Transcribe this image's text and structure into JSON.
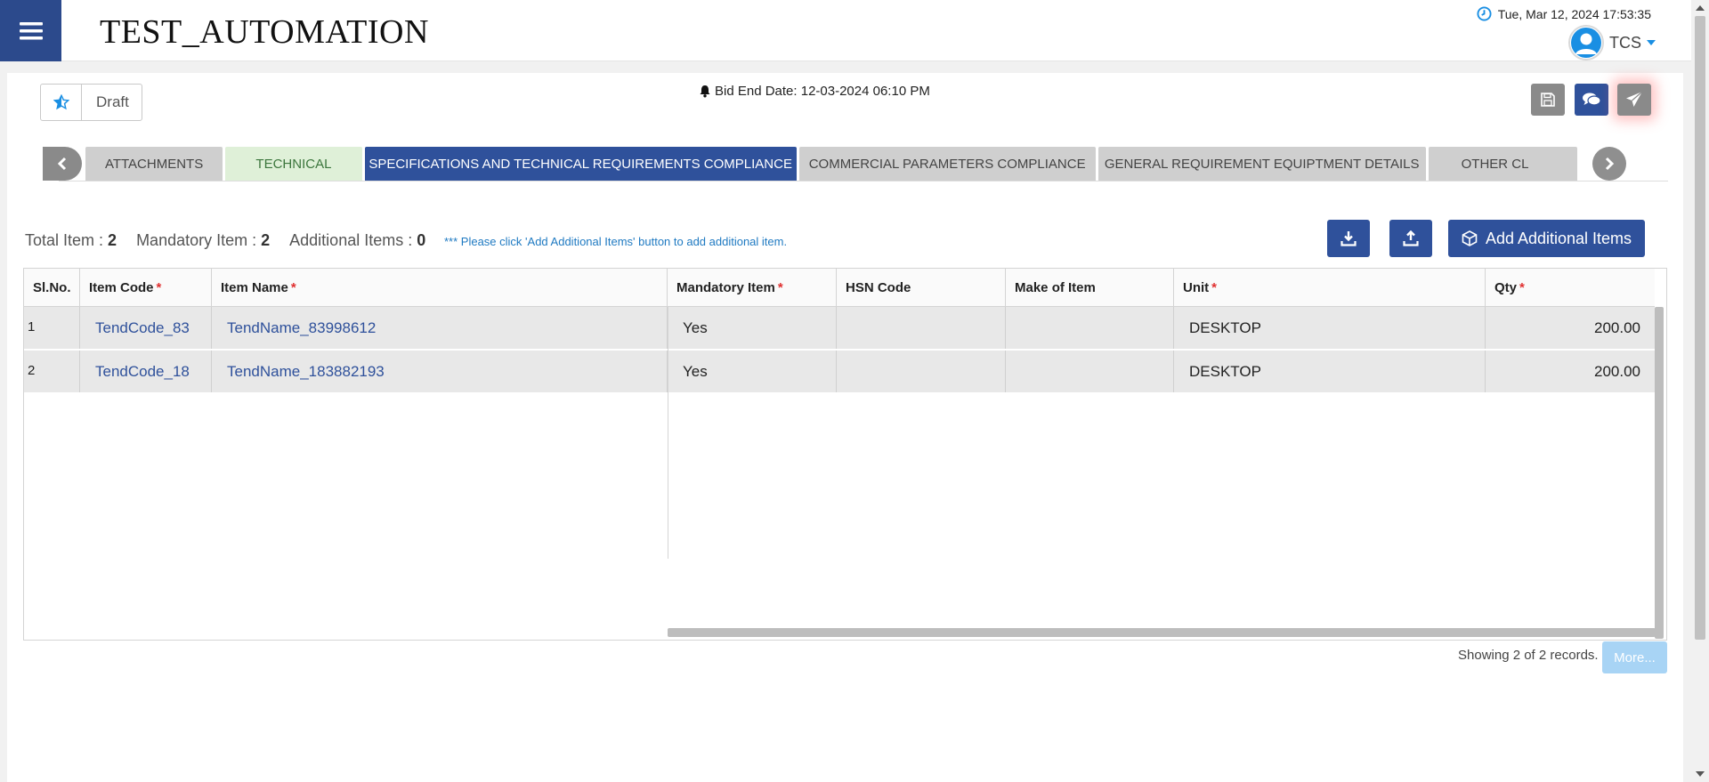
{
  "app": {
    "title": "TEST_AUTOMATION"
  },
  "header": {
    "datetime": "Tue, Mar 12, 2024 17:53:35",
    "user": "TCS"
  },
  "breadcrumb": {
    "status": "Draft"
  },
  "bid": {
    "end_label": "Bid End Date: 12-03-2024 06:10 PM"
  },
  "tabs": [
    {
      "label": "ATTACHMENTS",
      "state": "normal"
    },
    {
      "label": "TECHNICAL",
      "state": "success"
    },
    {
      "label": "SPECIFICATIONS AND TECHNICAL REQUIREMENTS COMPLIANCE",
      "state": "active"
    },
    {
      "label": "COMMERCIAL PARAMETERS COMPLIANCE",
      "state": "normal"
    },
    {
      "label": "GENERAL REQUIREMENT EQUIPTMENT DETAILS",
      "state": "normal"
    },
    {
      "label": "OTHER CL",
      "state": "normal"
    }
  ],
  "summary": {
    "total_label": "Total Item :",
    "total_value": "2",
    "mandatory_label": "Mandatory Item :",
    "mandatory_value": "2",
    "additional_label": "Additional Items :",
    "additional_value": "0",
    "note": "*** Please click 'Add Additional Items' button to add additional item."
  },
  "toolbar": {
    "add_label": "Add Additional Items"
  },
  "table": {
    "columns": [
      {
        "label": "Sl.No.",
        "required": false
      },
      {
        "label": "Item Code",
        "required": true
      },
      {
        "label": "Item Name",
        "required": true
      },
      {
        "label": "Mandatory Item",
        "required": true
      },
      {
        "label": "HSN Code",
        "required": false
      },
      {
        "label": "Make of Item",
        "required": false
      },
      {
        "label": "Unit",
        "required": true
      },
      {
        "label": "Qty",
        "required": true
      }
    ],
    "rows": [
      {
        "sl": "1",
        "code": "TendCode_83",
        "name": "TendName_83998612",
        "mandatory": "Yes",
        "hsn": "",
        "make": "",
        "unit": "DESKTOP",
        "qty": "200.00"
      },
      {
        "sl": "2",
        "code": "TendCode_18",
        "name": "TendName_183882193",
        "mandatory": "Yes",
        "hsn": "",
        "make": "",
        "unit": "DESKTOP",
        "qty": "200.00"
      }
    ]
  },
  "footer": {
    "showing": "Showing 2 of 2 records.",
    "more_label": "More..."
  },
  "colors": {
    "primary": "#2f519b",
    "success_bg": "#dff0d8",
    "required": "#e03030",
    "link": "#1f7ac2"
  }
}
